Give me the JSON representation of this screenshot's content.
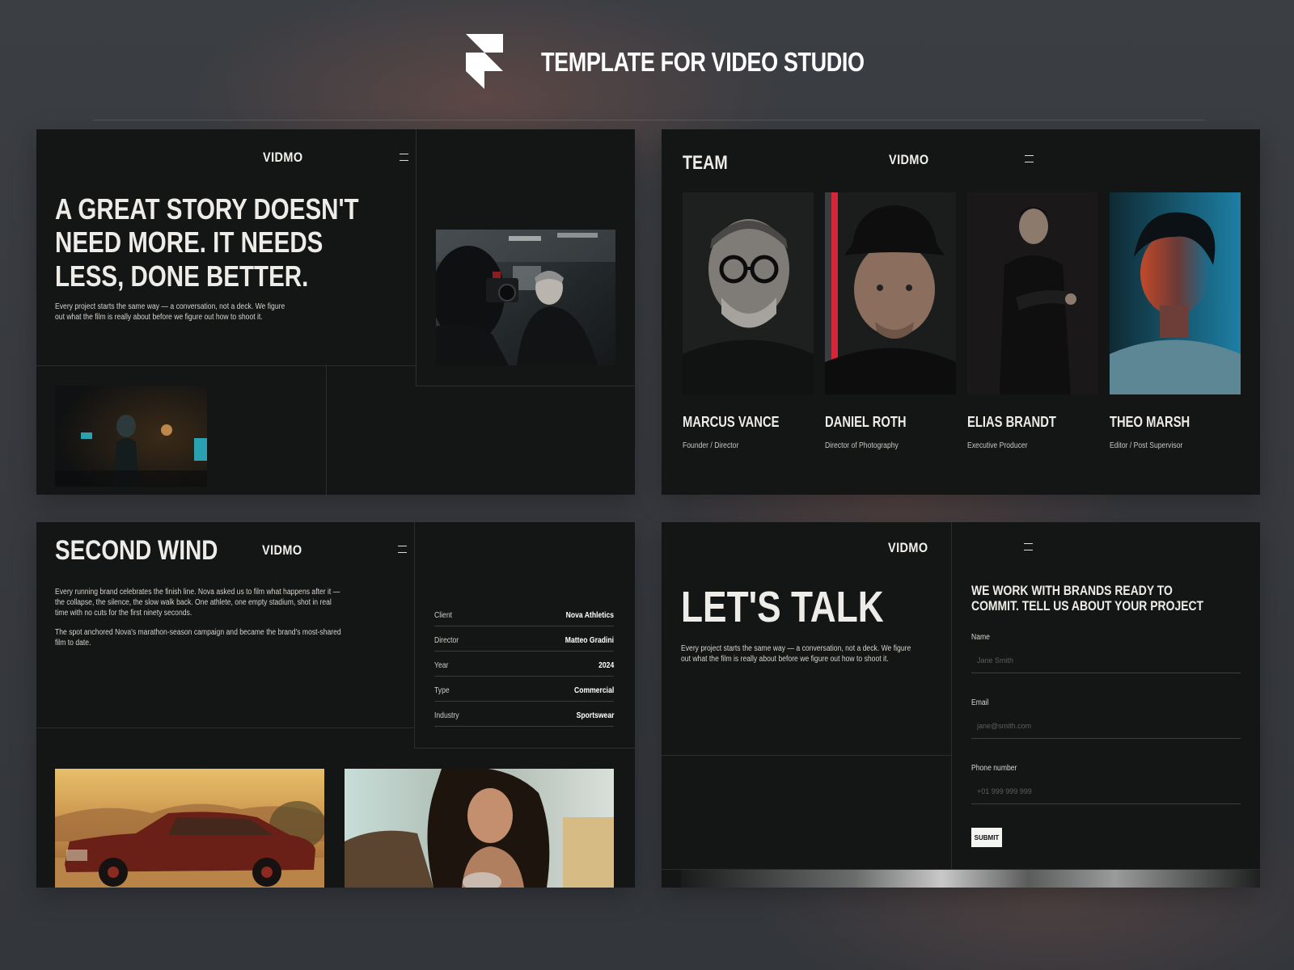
{
  "header": {
    "title": "TEMPLATE FOR VIDEO STUDIO"
  },
  "brand": {
    "nav_logo": "VIDMO"
  },
  "hero": {
    "headline_lines": [
      "A GREAT STORY DOESN'T",
      "NEED MORE. IT NEEDS",
      "LESS, DONE BETTER."
    ],
    "body_lines": [
      "Every project starts the same way — a conversation, not a deck. We figure",
      "out what the film is really about before we figure out how to shoot it."
    ]
  },
  "team": {
    "title": "TEAM",
    "members": [
      {
        "name": "MARCUS VANCE",
        "role": "Founder / Director"
      },
      {
        "name": "DANIEL ROTH",
        "role": "Director of Photography"
      },
      {
        "name": "ELIAS BRANDT",
        "role": "Executive Producer"
      },
      {
        "name": "THEO MARSH",
        "role": "Editor / Post Supervisor"
      }
    ]
  },
  "project": {
    "title": "SECOND WIND",
    "paragraph1_lines": [
      "Every running brand celebrates the finish line. Nova asked us to film what happens after it —",
      "the collapse, the silence, the slow walk back. One athlete, one empty stadium, shot in real",
      "time with no cuts for the first ninety seconds."
    ],
    "paragraph2_lines": [
      "The spot anchored Nova's marathon-season campaign and became the brand's most-shared",
      "film to date."
    ],
    "meta": [
      {
        "label": "Client",
        "value": "Nova Athletics"
      },
      {
        "label": "Director",
        "value": "Matteo Gradini"
      },
      {
        "label": "Year",
        "value": "2024"
      },
      {
        "label": "Type",
        "value": "Commercial"
      },
      {
        "label": "Industry",
        "value": "Sportswear"
      }
    ]
  },
  "contact": {
    "title": "LET'S TALK",
    "body_lines": [
      "Every project starts the same way — a conversation, not a deck. We figure",
      "out what the film is really about before we figure out how to shoot it."
    ],
    "form_heading_lines": [
      "WE WORK WITH BRANDS READY TO",
      "COMMIT. TELL US ABOUT YOUR PROJECT"
    ],
    "fields": [
      {
        "label": "Name",
        "placeholder": "Jane Smith"
      },
      {
        "label": "Email",
        "placeholder": "jane@smith.com"
      },
      {
        "label": "Phone number",
        "placeholder": "+01 999 999 999"
      }
    ],
    "submit_label": "SUBMIT"
  },
  "colors": {
    "panel_bg": "#141515",
    "accent_red": "#d6263a",
    "accent_teal": "#1c8fb5",
    "text": "#eeece8"
  }
}
